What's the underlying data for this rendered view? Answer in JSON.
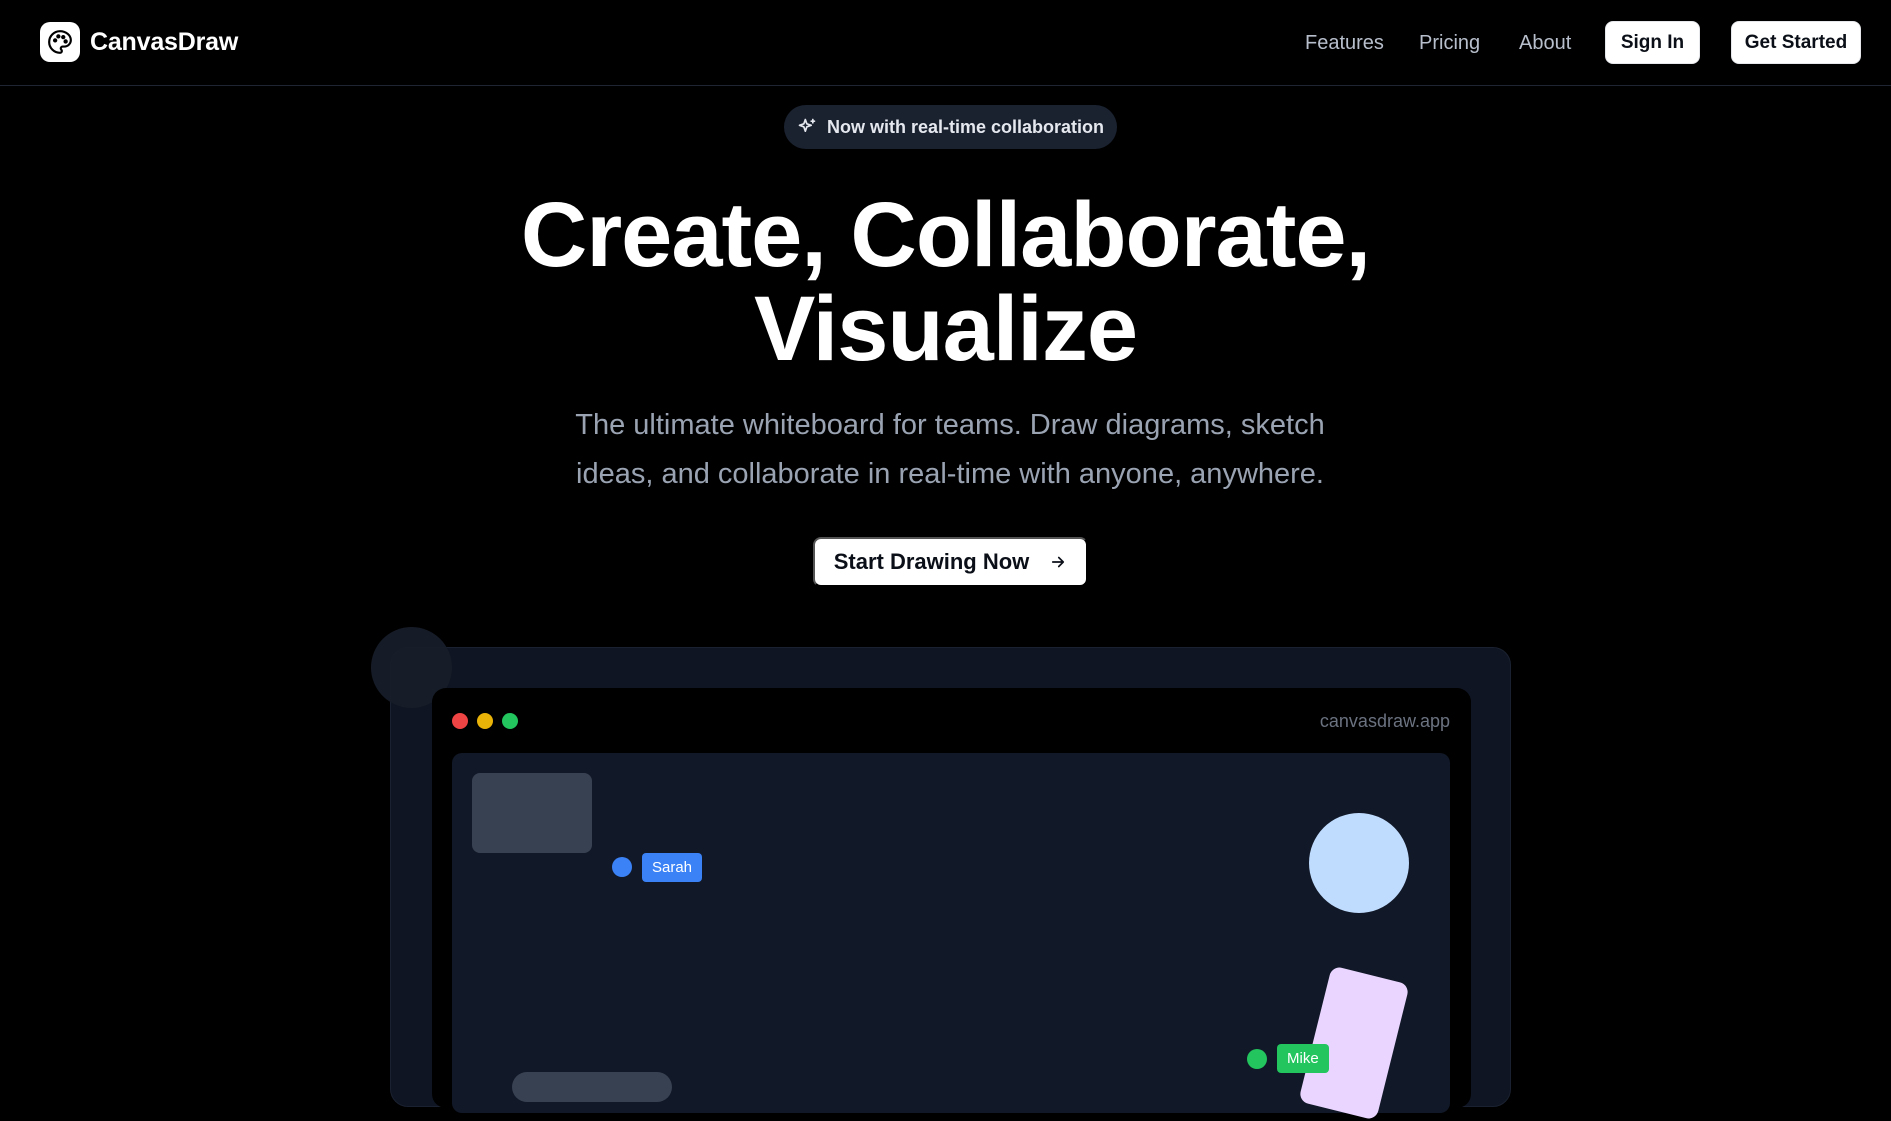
{
  "brand": {
    "name": "CanvasDraw",
    "logo_icon": "palette-icon"
  },
  "nav": {
    "links": [
      "Features",
      "Pricing",
      "About"
    ],
    "sign_in": "Sign In",
    "get_started": "Get Started"
  },
  "hero": {
    "badge": "Now with real-time collaboration",
    "badge_icon": "sparkles-icon",
    "title_line1": "Create, Collaborate,",
    "title_line2": "Visualize",
    "subtitle_line1": "The ultimate whiteboard for teams. Draw diagrams, sketch",
    "subtitle_line2": "ideas, and collaborate in real-time with anyone, anywhere.",
    "cta": "Start Drawing Now",
    "cta_icon": "arrow-right-icon"
  },
  "preview": {
    "url": "canvasdraw.app",
    "window_dots": [
      "#ef4444",
      "#eab308",
      "#22c55e"
    ],
    "cursors": [
      {
        "name": "Sarah",
        "color": "#3b82f6"
      },
      {
        "name": "Mike",
        "color": "#22c55e"
      }
    ]
  },
  "colors": {
    "background": "#000000",
    "accent_blue": "#bfdbfe",
    "accent_purple": "#e9d5ff"
  }
}
